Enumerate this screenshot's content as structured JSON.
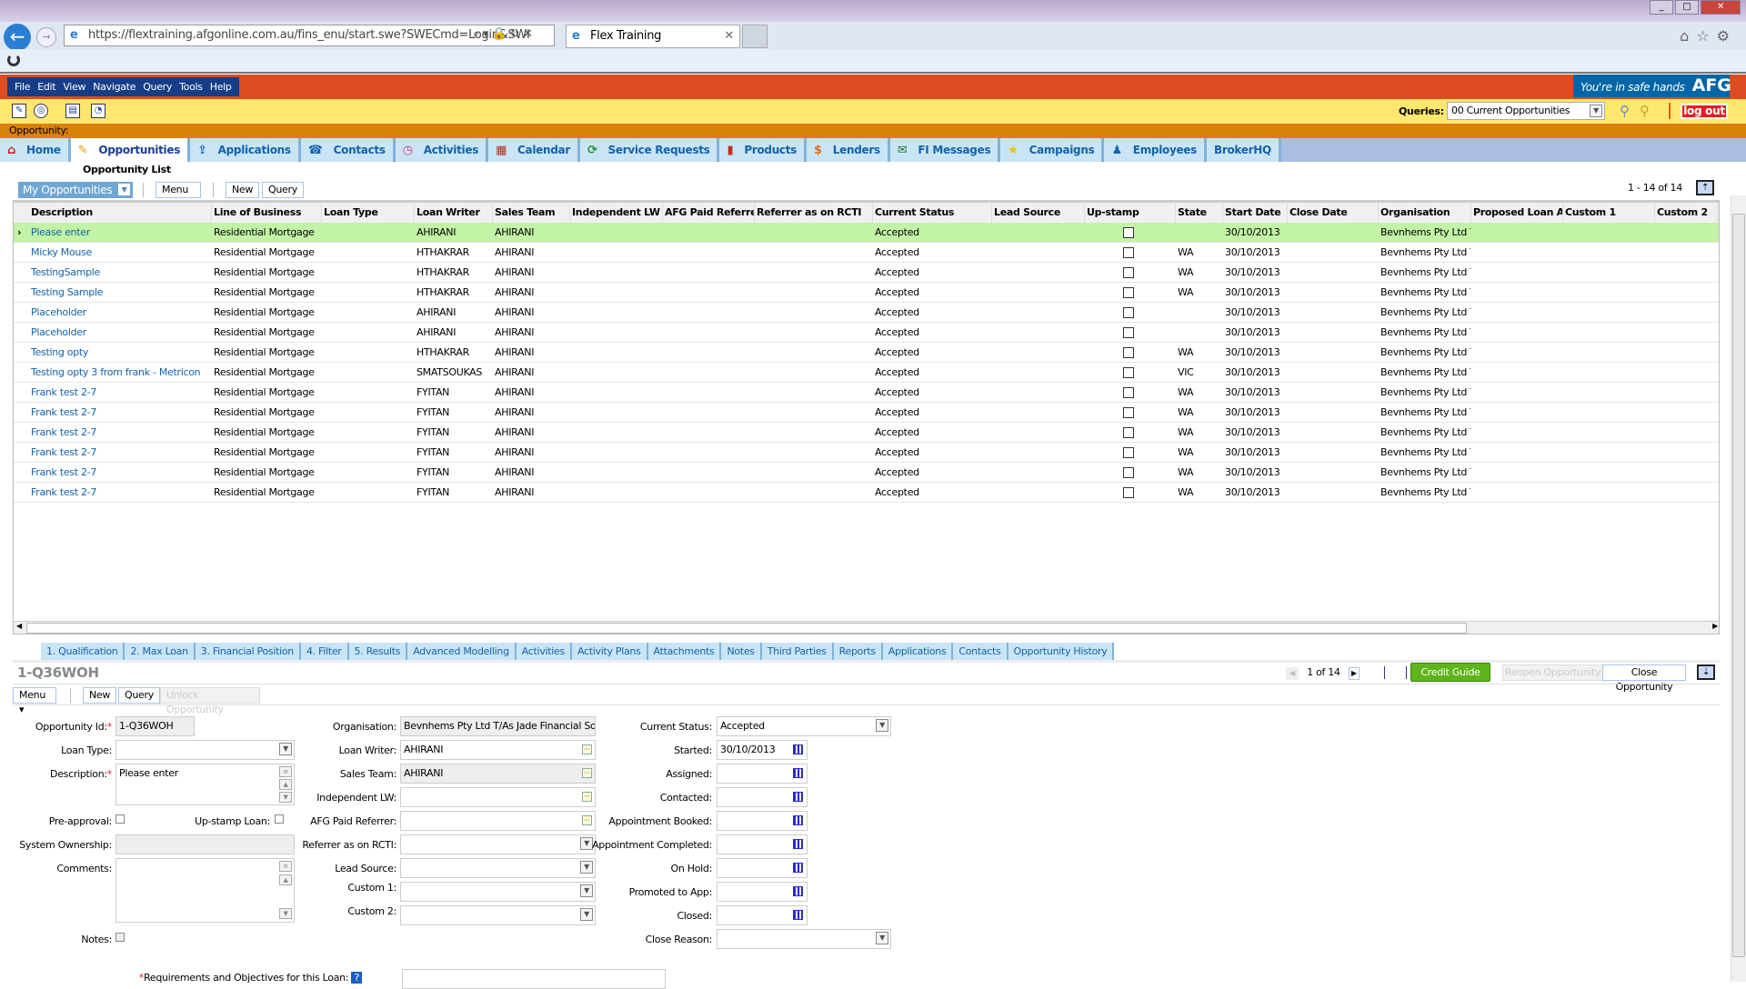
{
  "browser": {
    "url": "https://flextraining.afgonline.com.au/fins_enu/start.swe?SWECmd=Login&SWI",
    "tab_title": "Flex Training"
  },
  "app": {
    "menus": [
      "File",
      "Edit",
      "View",
      "Navigate",
      "Query",
      "Tools",
      "Help"
    ],
    "brand_tagline": "You're in safe hands",
    "brand_logo": "AFG",
    "queries_label": "Queries:",
    "queries_value": "00 Current Opportunities",
    "logout_label": "log out",
    "context_label": "Opportunity:",
    "screen_tabs": [
      {
        "label": "Home",
        "icon": "home-icon"
      },
      {
        "label": "Opportunities",
        "icon": "pencil-icon",
        "active": true
      },
      {
        "label": "Applications",
        "icon": "upload-icon"
      },
      {
        "label": "Contacts",
        "icon": "address-book-icon"
      },
      {
        "label": "Activities",
        "icon": "clock-icon"
      },
      {
        "label": "Calendar",
        "icon": "calendar-icon"
      },
      {
        "label": "Service Requests",
        "icon": "refresh-icon"
      },
      {
        "label": "Products",
        "icon": "bar-chart-icon"
      },
      {
        "label": "Lenders",
        "icon": "money-bag-icon"
      },
      {
        "label": "FI Messages",
        "icon": "envelope-icon"
      },
      {
        "label": "Campaigns",
        "icon": "star-icon"
      },
      {
        "label": "Employees",
        "icon": "person-icon"
      },
      {
        "label": "BrokerHQ",
        "icon": ""
      }
    ]
  },
  "list": {
    "title": "Opportunity List",
    "visibility": "My Opportunities",
    "menu_label": "Menu",
    "new_label": "New",
    "query_label": "Query",
    "count": "1 - 14 of 14",
    "columns": [
      "Description",
      "Line of Business",
      "Loan Type",
      "Loan Writer",
      "Sales Team",
      "Independent LW",
      "AFG Paid Referre",
      "Referrer as on RCTI",
      "Current Status",
      "Lead Source",
      "Up-stamp",
      "State",
      "Start Date",
      "Close Date",
      "Organisation",
      "Proposed Loan Ar",
      "Custom 1",
      "Custom 2"
    ],
    "rows": [
      {
        "description": "Please enter",
        "lob": "Residential Mortgage",
        "loan_writer": "AHIRANI",
        "sales_team": "AHIRANI",
        "status": "Accepted",
        "upstamp": false,
        "state": "",
        "start": "30/10/2013",
        "org": "Bevnhems Pty Ltd T,"
      },
      {
        "description": "Micky Mouse",
        "lob": "Residential Mortgage",
        "loan_writer": "HTHAKRAR",
        "sales_team": "AHIRANI",
        "status": "Accepted",
        "upstamp": false,
        "state": "WA",
        "start": "30/10/2013",
        "org": "Bevnhems Pty Ltd T,"
      },
      {
        "description": "TestingSample",
        "lob": "Residential Mortgage",
        "loan_writer": "HTHAKRAR",
        "sales_team": "AHIRANI",
        "status": "Accepted",
        "upstamp": false,
        "state": "WA",
        "start": "30/10/2013",
        "org": "Bevnhems Pty Ltd T,"
      },
      {
        "description": "Testing Sample",
        "lob": "Residential Mortgage",
        "loan_writer": "HTHAKRAR",
        "sales_team": "AHIRANI",
        "status": "Accepted",
        "upstamp": false,
        "state": "WA",
        "start": "30/10/2013",
        "org": "Bevnhems Pty Ltd T,"
      },
      {
        "description": "Placeholder",
        "lob": "Residential Mortgage",
        "loan_writer": "AHIRANI",
        "sales_team": "AHIRANI",
        "status": "Accepted",
        "upstamp": false,
        "state": "",
        "start": "30/10/2013",
        "org": "Bevnhems Pty Ltd T,"
      },
      {
        "description": "Placeholder",
        "lob": "Residential Mortgage",
        "loan_writer": "AHIRANI",
        "sales_team": "AHIRANI",
        "status": "Accepted",
        "upstamp": false,
        "state": "",
        "start": "30/10/2013",
        "org": "Bevnhems Pty Ltd T,"
      },
      {
        "description": "Testing opty",
        "lob": "Residential Mortgage",
        "loan_writer": "HTHAKRAR",
        "sales_team": "AHIRANI",
        "status": "Accepted",
        "upstamp": false,
        "state": "WA",
        "start": "30/10/2013",
        "org": "Bevnhems Pty Ltd T,"
      },
      {
        "description": "Testing opty 3 from frank - Metricon",
        "lob": "Residential Mortgage",
        "loan_writer": "SMATSOUKAS",
        "sales_team": "AHIRANI",
        "status": "Accepted",
        "upstamp": false,
        "state": "VIC",
        "start": "30/10/2013",
        "org": "Bevnhems Pty Ltd T,"
      },
      {
        "description": "Frank test 2-7",
        "lob": "Residential Mortgage",
        "loan_writer": "FYITAN",
        "sales_team": "AHIRANI",
        "status": "Accepted",
        "upstamp": false,
        "state": "WA",
        "start": "30/10/2013",
        "org": "Bevnhems Pty Ltd T,"
      },
      {
        "description": "Frank test 2-7",
        "lob": "Residential Mortgage",
        "loan_writer": "FYITAN",
        "sales_team": "AHIRANI",
        "status": "Accepted",
        "upstamp": false,
        "state": "WA",
        "start": "30/10/2013",
        "org": "Bevnhems Pty Ltd T,"
      },
      {
        "description": "Frank test 2-7",
        "lob": "Residential Mortgage",
        "loan_writer": "FYITAN",
        "sales_team": "AHIRANI",
        "status": "Accepted",
        "upstamp": false,
        "state": "WA",
        "start": "30/10/2013",
        "org": "Bevnhems Pty Ltd T,"
      },
      {
        "description": "Frank test 2-7",
        "lob": "Residential Mortgage",
        "loan_writer": "FYITAN",
        "sales_team": "AHIRANI",
        "status": "Accepted",
        "upstamp": false,
        "state": "WA",
        "start": "30/10/2013",
        "org": "Bevnhems Pty Ltd T,"
      },
      {
        "description": "Frank test 2-7",
        "lob": "Residential Mortgage",
        "loan_writer": "FYITAN",
        "sales_team": "AHIRANI",
        "status": "Accepted",
        "upstamp": false,
        "state": "WA",
        "start": "30/10/2013",
        "org": "Bevnhems Pty Ltd T,"
      },
      {
        "description": "Frank test 2-7",
        "lob": "Residential Mortgage",
        "loan_writer": "FYITAN",
        "sales_team": "AHIRANI",
        "status": "Accepted",
        "upstamp": false,
        "state": "WA",
        "start": "30/10/2013",
        "org": "Bevnhems Pty Ltd T,"
      }
    ]
  },
  "view_tabs": [
    "1. Qualification",
    "2. Max Loan",
    "3. Financial Position",
    "4. Filter",
    "5. Results",
    "Advanced Modelling",
    "Activities",
    "Activity Plans",
    "Attachments",
    "Notes",
    "Third Parties",
    "Reports",
    "Applications",
    "Contacts",
    "Opportunity History"
  ],
  "record": {
    "title": "1-Q36WOH",
    "menu_label": "Menu",
    "new_label": "New",
    "query_label": "Query",
    "unlock_label": "Unlock Opportunity",
    "position": "1 of 14",
    "credit_guide": "Credit Guide",
    "reopen": "Reopen Opportunity",
    "close": "Close Opportunity",
    "fields": {
      "opportunity_id": {
        "label": "Opportunity Id:",
        "value": "1-Q36WOH"
      },
      "loan_type": {
        "label": "Loan Type:",
        "value": ""
      },
      "description": {
        "label": "Description:",
        "value": "Please enter"
      },
      "pre_approval": {
        "label": "Pre-approval:"
      },
      "upstamp_loan": {
        "label": "Up-stamp Loan:"
      },
      "system_ownership": {
        "label": "System Ownership:",
        "value": ""
      },
      "comments": {
        "label": "Comments:",
        "value": ""
      },
      "notes": {
        "label": "Notes:"
      },
      "organisation": {
        "label": "Organisation:",
        "value": "Bevnhems Pty Ltd T/As Jade Financial Soluti"
      },
      "loan_writer": {
        "label": "Loan Writer:",
        "value": "AHIRANI"
      },
      "sales_team": {
        "label": "Sales Team:",
        "value": "AHIRANI"
      },
      "independent_lw": {
        "label": "Independent LW:",
        "value": ""
      },
      "afg_paid_referrer": {
        "label": "AFG Paid Referrer:",
        "value": ""
      },
      "referrer_rcti": {
        "label": "Referrer as on RCTI:",
        "value": ""
      },
      "lead_source": {
        "label": "Lead Source:",
        "value": ""
      },
      "custom1": {
        "label": "Custom 1:",
        "value": ""
      },
      "custom2": {
        "label": "Custom 2:",
        "value": ""
      },
      "requirements": {
        "label": "Requirements and Objectives for this Loan:"
      },
      "current_status": {
        "label": "Current Status:",
        "value": "Accepted"
      },
      "started": {
        "label": "Started:",
        "value": "30/10/2013"
      },
      "assigned": {
        "label": "Assigned:",
        "value": ""
      },
      "contacted": {
        "label": "Contacted:",
        "value": ""
      },
      "appt_booked": {
        "label": "Appointment Booked:",
        "value": ""
      },
      "appt_completed": {
        "label": "Appointment Completed:",
        "value": ""
      },
      "on_hold": {
        "label": "On Hold:",
        "value": ""
      },
      "promoted": {
        "label": "Promoted to App:",
        "value": ""
      },
      "closed": {
        "label": "Closed:",
        "value": ""
      },
      "close_reason": {
        "label": "Close Reason:",
        "value": ""
      }
    }
  },
  "colors": {
    "menubar": "#db4c20",
    "toolbar": "#ffe76f",
    "context": "#d9820a",
    "tab": "#c9e5f5",
    "selected_row": "#c2f3a6",
    "link": "#1562a9",
    "credit_guide": "#5fb41c",
    "logout": "#e31e24",
    "brand": "#0466a6"
  }
}
